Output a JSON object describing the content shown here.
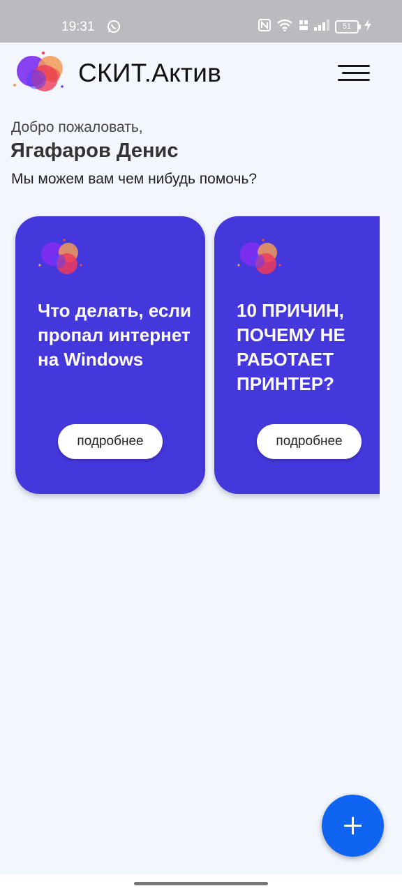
{
  "status_bar": {
    "time": "19:31",
    "battery": "51"
  },
  "header": {
    "app_title": "СКИТ.Актив",
    "logo_icon": "skit-logo-icon",
    "menu_icon": "hamburger-menu-icon"
  },
  "greeting": {
    "welcome": "Добро пожаловать,",
    "user_name": "Ягафаров Денис",
    "help_text": "Мы можем вам чем нибудь помочь?"
  },
  "cards": [
    {
      "title": "Что делать, если пропал интернет на Windows",
      "button_label": "подробнее"
    },
    {
      "title": "10 ПРИЧИН, ПОЧЕМУ НЕ РАБОТАЕТ ПРИНТЕР?",
      "button_label": "подробнее"
    }
  ],
  "fab": {
    "icon": "plus-icon"
  },
  "colors": {
    "background": "#f3f7fd",
    "card": "#4438dc",
    "fab": "#0f64f2",
    "status_bar": "#b9bbbe"
  }
}
